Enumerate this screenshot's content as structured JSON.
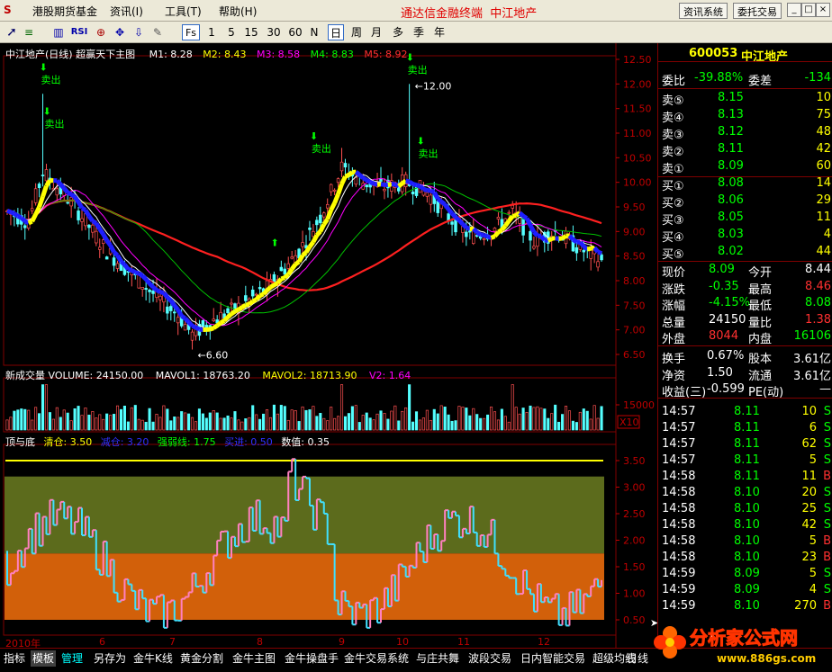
{
  "menu": {
    "items": [
      "港股期货基金",
      "资讯(I)",
      "工具(T)",
      "帮助(H)"
    ],
    "brand_title": "通达信金融终端",
    "stock_title": "中江地产",
    "right_buttons": [
      "资讯系统",
      "委托交易"
    ],
    "window_buttons": [
      "_",
      "□",
      "×"
    ]
  },
  "toolbar": {
    "periods": [
      "1",
      "5",
      "15",
      "30",
      "60",
      "N",
      "日",
      "周",
      "月",
      "多",
      "季",
      "年"
    ],
    "selected_period": "日",
    "fs_label": "Fs"
  },
  "main_chart": {
    "title": "中江地产(日线) 超赢天下主图",
    "ma_labels": [
      {
        "text": "M1: 8.28",
        "color": "#ffffff"
      },
      {
        "text": "M2: 8.43",
        "color": "#ffff00"
      },
      {
        "text": "M3: 8.58",
        "color": "#ff00ff"
      },
      {
        "text": "M4: 8.83",
        "color": "#00ff00"
      },
      {
        "text": "M5: 8.92",
        "color": "#ff0000"
      }
    ],
    "y_ticks": [
      "12.50",
      "12.00",
      "11.50",
      "11.00",
      "10.50",
      "10.00",
      "9.50",
      "9.00",
      "8.50",
      "8.00",
      "7.50",
      "7.00",
      "6.50"
    ],
    "annotations": {
      "sell": "卖出",
      "high": "12.00",
      "low": "6.60"
    }
  },
  "volume_chart": {
    "labels": [
      {
        "text": "新成交量 VOLUME: 24150.00",
        "color": "#ffffff"
      },
      {
        "text": "MAVOL1: 18763.20",
        "color": "#ffffff"
      },
      {
        "text": "MAVOL2: 18713.90",
        "color": "#ffff00"
      },
      {
        "text": "V2: 1.64",
        "color": "#ff00ff"
      }
    ],
    "y_tick": "15000",
    "scale_label": "X10"
  },
  "indicator_chart": {
    "labels": [
      {
        "text": "顶与底",
        "color": "#ffffff"
      },
      {
        "text": "清仓: 3.50",
        "color": "#ffff00"
      },
      {
        "text": "减仓: 3.20",
        "color": "#3030ff"
      },
      {
        "text": "强弱线: 1.75",
        "color": "#00ff00"
      },
      {
        "text": "买进: 0.50",
        "color": "#3030ff"
      },
      {
        "text": "数值: 0.35",
        "color": "#ffffff"
      }
    ],
    "y_ticks": [
      "3.50",
      "3.00",
      "2.50",
      "2.00",
      "1.50",
      "1.00",
      "0.50"
    ]
  },
  "date_axis": [
    "2010年",
    "6",
    "7",
    "8",
    "9",
    "10",
    "11",
    "12"
  ],
  "quote_panel": {
    "code": "600053",
    "name": "中江地产",
    "wei_bi_label": "委比",
    "wei_bi_value": "-39.88%",
    "wei_cha_label": "委差",
    "wei_cha_value": "-134",
    "asks": [
      {
        "label": "卖⑤",
        "price": "8.15",
        "vol": "10"
      },
      {
        "label": "卖④",
        "price": "8.13",
        "vol": "75"
      },
      {
        "label": "卖③",
        "price": "8.12",
        "vol": "48"
      },
      {
        "label": "卖②",
        "price": "8.11",
        "vol": "42"
      },
      {
        "label": "卖①",
        "price": "8.09",
        "vol": "60"
      }
    ],
    "bids": [
      {
        "label": "买①",
        "price": "8.08",
        "vol": "14"
      },
      {
        "label": "买②",
        "price": "8.06",
        "vol": "29"
      },
      {
        "label": "买③",
        "price": "8.05",
        "vol": "11"
      },
      {
        "label": "买④",
        "price": "8.03",
        "vol": "4"
      },
      {
        "label": "买⑤",
        "price": "8.02",
        "vol": "44"
      }
    ],
    "stats": [
      {
        "l1": "现价",
        "v1": "8.09",
        "l2": "今开",
        "v2": "8.44",
        "c1": "#00ff00",
        "c2": "#ffffff"
      },
      {
        "l1": "涨跌",
        "v1": "-0.35",
        "l2": "最高",
        "v2": "8.46",
        "c1": "#00ff00",
        "c2": "#ff3030"
      },
      {
        "l1": "涨幅",
        "v1": "-4.15%",
        "l2": "最低",
        "v2": "8.08",
        "c1": "#00ff00",
        "c2": "#00ff00"
      },
      {
        "l1": "总量",
        "v1": "24150",
        "l2": "量比",
        "v2": "1.38",
        "c1": "#ffffff",
        "c2": "#ff3030"
      },
      {
        "l1": "外盘",
        "v1": "8044",
        "l2": "内盘",
        "v2": "16106",
        "c1": "#ff3030",
        "c2": "#00ff00"
      }
    ],
    "fundamentals": [
      {
        "l1": "换手",
        "v1": "0.67%",
        "l2": "股本",
        "v2": "3.61亿"
      },
      {
        "l1": "净资",
        "v1": "1.50",
        "l2": "流通",
        "v2": "3.61亿"
      },
      {
        "l1": "收益(三)",
        "v1": "-0.599",
        "l2": "PE(动)",
        "v2": "—"
      }
    ],
    "ticks": [
      {
        "t": "14:57",
        "p": "8.11",
        "v": "10",
        "s": "S"
      },
      {
        "t": "14:57",
        "p": "8.11",
        "v": "6",
        "s": "S"
      },
      {
        "t": "14:57",
        "p": "8.11",
        "v": "62",
        "s": "S"
      },
      {
        "t": "14:57",
        "p": "8.11",
        "v": "5",
        "s": "S"
      },
      {
        "t": "14:58",
        "p": "8.11",
        "v": "11",
        "s": "B"
      },
      {
        "t": "14:58",
        "p": "8.10",
        "v": "20",
        "s": "S"
      },
      {
        "t": "14:58",
        "p": "8.10",
        "v": "25",
        "s": "S"
      },
      {
        "t": "14:58",
        "p": "8.10",
        "v": "42",
        "s": "S"
      },
      {
        "t": "14:58",
        "p": "8.10",
        "v": "5",
        "s": "B"
      },
      {
        "t": "14:58",
        "p": "8.10",
        "v": "23",
        "s": "B"
      },
      {
        "t": "14:59",
        "p": "8.09",
        "v": "5",
        "s": "S"
      },
      {
        "t": "14:59",
        "p": "8.09",
        "v": "4",
        "s": "S"
      },
      {
        "t": "14:59",
        "p": "8.10",
        "v": "270",
        "s": "B"
      }
    ]
  },
  "bottom_tabs": [
    "指标",
    "模板",
    "管理",
    "另存为",
    "金牛K线",
    "黄金分割",
    "金牛主图",
    "金牛操盘手",
    "金牛交易系统",
    "与庄共舞",
    "波段交易",
    "日内智能交易",
    "超级均线"
  ],
  "bottom_right": "日线",
  "watermark": {
    "text": "分析家公式网",
    "url": "www.886gs.com"
  }
}
